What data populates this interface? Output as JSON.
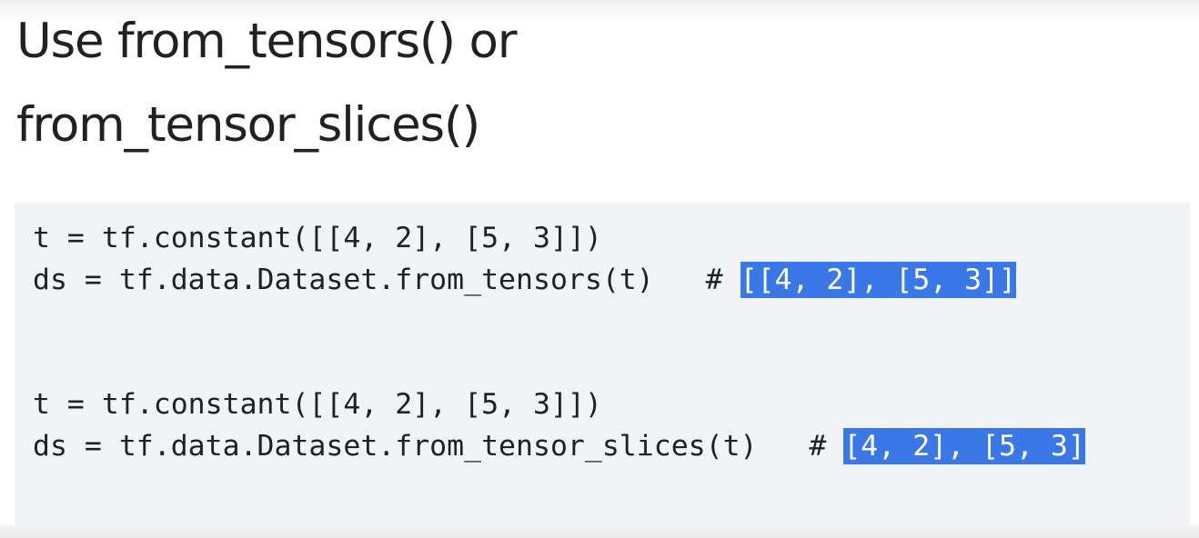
{
  "slide": {
    "title_line1": "Use from_tensors() or",
    "title_line2": "from_tensor_slices()"
  },
  "code": {
    "block1": {
      "line1": "t = tf.constant([[4, 2], [5, 3]])",
      "line2": "ds = tf.data.Dataset.from_tensors(t)   # ",
      "line2_result": "[[4, 2], [5, 3]]"
    },
    "block2": {
      "line1": "t = tf.constant([[4, 2], [5, 3]])",
      "line2": "ds = tf.data.Dataset.from_tensor_slices(t)   # ",
      "line2_result": "[4, 2], [5, 3]"
    }
  },
  "colors": {
    "highlight": "#3b78e7",
    "code_background": "#f1f3f4",
    "text": "#202124"
  }
}
